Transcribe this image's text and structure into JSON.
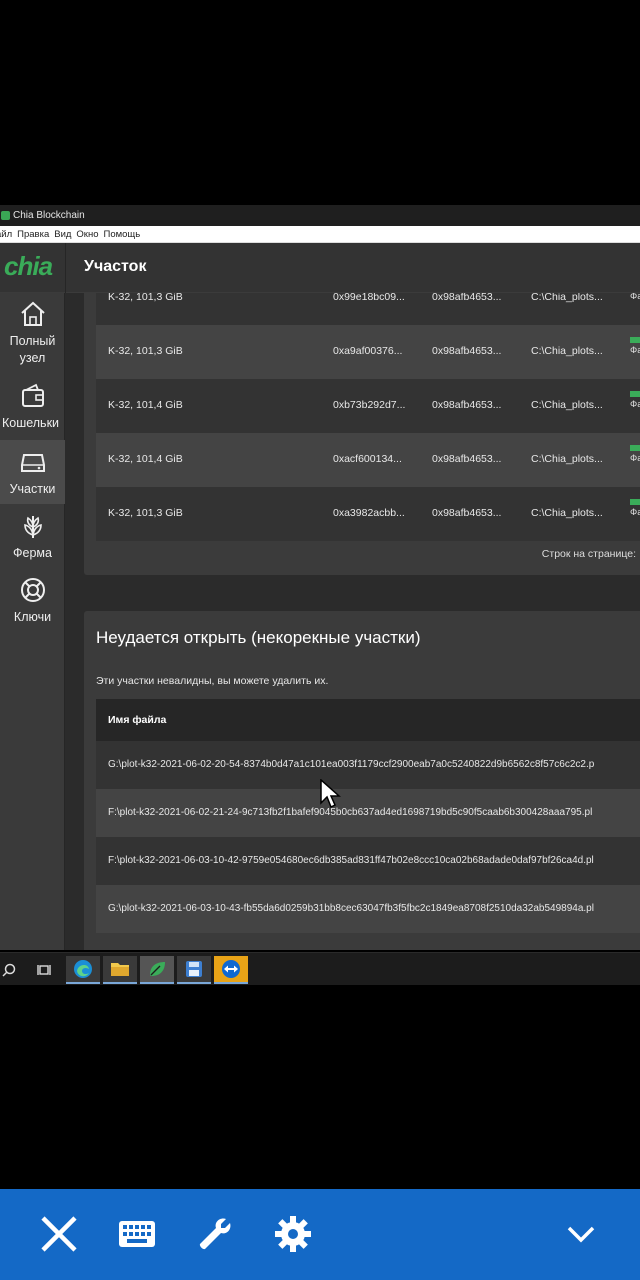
{
  "window": {
    "title": "Chia Blockchain"
  },
  "menu": [
    "айл",
    "Правка",
    "Вид",
    "Окно",
    "Помощь"
  ],
  "header": {
    "logo": "chia",
    "page_title": "Участок"
  },
  "sidebar": {
    "items": [
      {
        "label_line1": "Полный",
        "label_line2": "узел",
        "icon": "home-icon"
      },
      {
        "label_line1": "Кошельки",
        "icon": "wallet-icon"
      },
      {
        "label_line1": "Участки",
        "icon": "hard-drive-icon",
        "active": true
      },
      {
        "label_line1": "Ферма",
        "icon": "sprout-icon"
      },
      {
        "label_line1": "Ключи",
        "icon": "lifebuoy-icon"
      }
    ]
  },
  "plots": {
    "status_label": "Фа",
    "rows": [
      {
        "size": "K-32, 101,3 GiB",
        "plot_key": "0xa9af00376...",
        "farmer_key": "0x98afb4653...",
        "path": "C:\\Chia_plots..."
      },
      {
        "size": "K-32, 101,4 GiB",
        "plot_key": "0xb73b292d7...",
        "farmer_key": "0x98afb4653...",
        "path": "C:\\Chia_plots..."
      },
      {
        "size": "K-32, 101,4 GiB",
        "plot_key": "0xacf600134...",
        "farmer_key": "0x98afb4653...",
        "path": "C:\\Chia_plots..."
      },
      {
        "size": "K-32, 101,3 GiB",
        "plot_key": "0xa3982acbb...",
        "farmer_key": "0x98afb4653...",
        "path": "C:\\Chia_plots..."
      }
    ],
    "partial_row": {
      "size": "K-32, 101,3 GiB",
      "plot_key": "0x99e18bc09...",
      "farmer_key": "0x98afb4653...",
      "path": "C:\\Chia_plots..."
    },
    "rows_per_page_label": "Строк на странице:"
  },
  "invalid": {
    "title": "Неудается открыть (некорекные участки)",
    "description": "Эти участки невалидны, вы можете удалить их.",
    "column_header": "Имя файла",
    "files": [
      "G:\\plot-k32-2021-06-02-20-54-8374b0d47a1c101ea003f1179ccf2900eab7a0c5240822d9b6562c8f57c6c2c2.p",
      "F:\\plot-k32-2021-06-02-21-24-9c713fb2f1bafef9045b0cb637ad4ed1698719bd5c90f5caab6b300428aaa795.pl",
      "F:\\plot-k32-2021-06-03-10-42-9759e054680ec6db385ad831ff47b02e8ccc10ca02b68adade0daf97bf26ca4d.pl",
      "G:\\plot-k32-2021-06-03-10-43-fb55da6d0259b31bb8cec63047fb3f5fbc2c1849ea8708f2510da32ab549894a.pl"
    ]
  },
  "colors": {
    "accent": "#3aac59",
    "bottom_bar": "#1469c6"
  }
}
